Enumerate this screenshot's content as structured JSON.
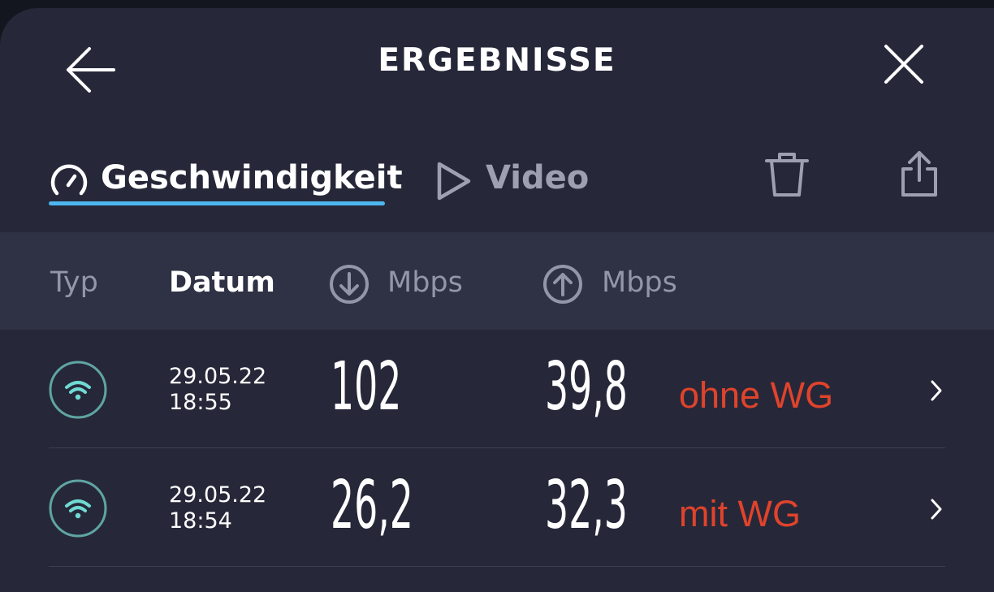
{
  "header": {
    "title": "ERGEBNISSE",
    "back_icon": "arrow-left-icon",
    "close_icon": "close-icon"
  },
  "tabs": [
    {
      "label": "Geschwindigkeit",
      "icon": "speedometer-icon",
      "active": true
    },
    {
      "label": "Video",
      "icon": "play-icon",
      "active": false
    }
  ],
  "toolbar": {
    "delete_icon": "trash-icon",
    "share_icon": "share-icon"
  },
  "columns": {
    "typ": "Typ",
    "datum": "Datum",
    "download_unit": "Mbps",
    "upload_unit": "Mbps"
  },
  "rows": [
    {
      "type_icon": "wifi-icon",
      "date": "29.05.22",
      "time": "18:55",
      "download": "102",
      "upload": "39,8",
      "note": "ohne WG"
    },
    {
      "type_icon": "wifi-icon",
      "date": "29.05.22",
      "time": "18:54",
      "download": "26,2",
      "upload": "32,3",
      "note": "mit WG"
    }
  ],
  "colors": {
    "background": "#262839",
    "header_band": "#2f3144",
    "accent": "#4eb7f0",
    "wifi": "#6fdad3",
    "note": "#e0432b"
  }
}
